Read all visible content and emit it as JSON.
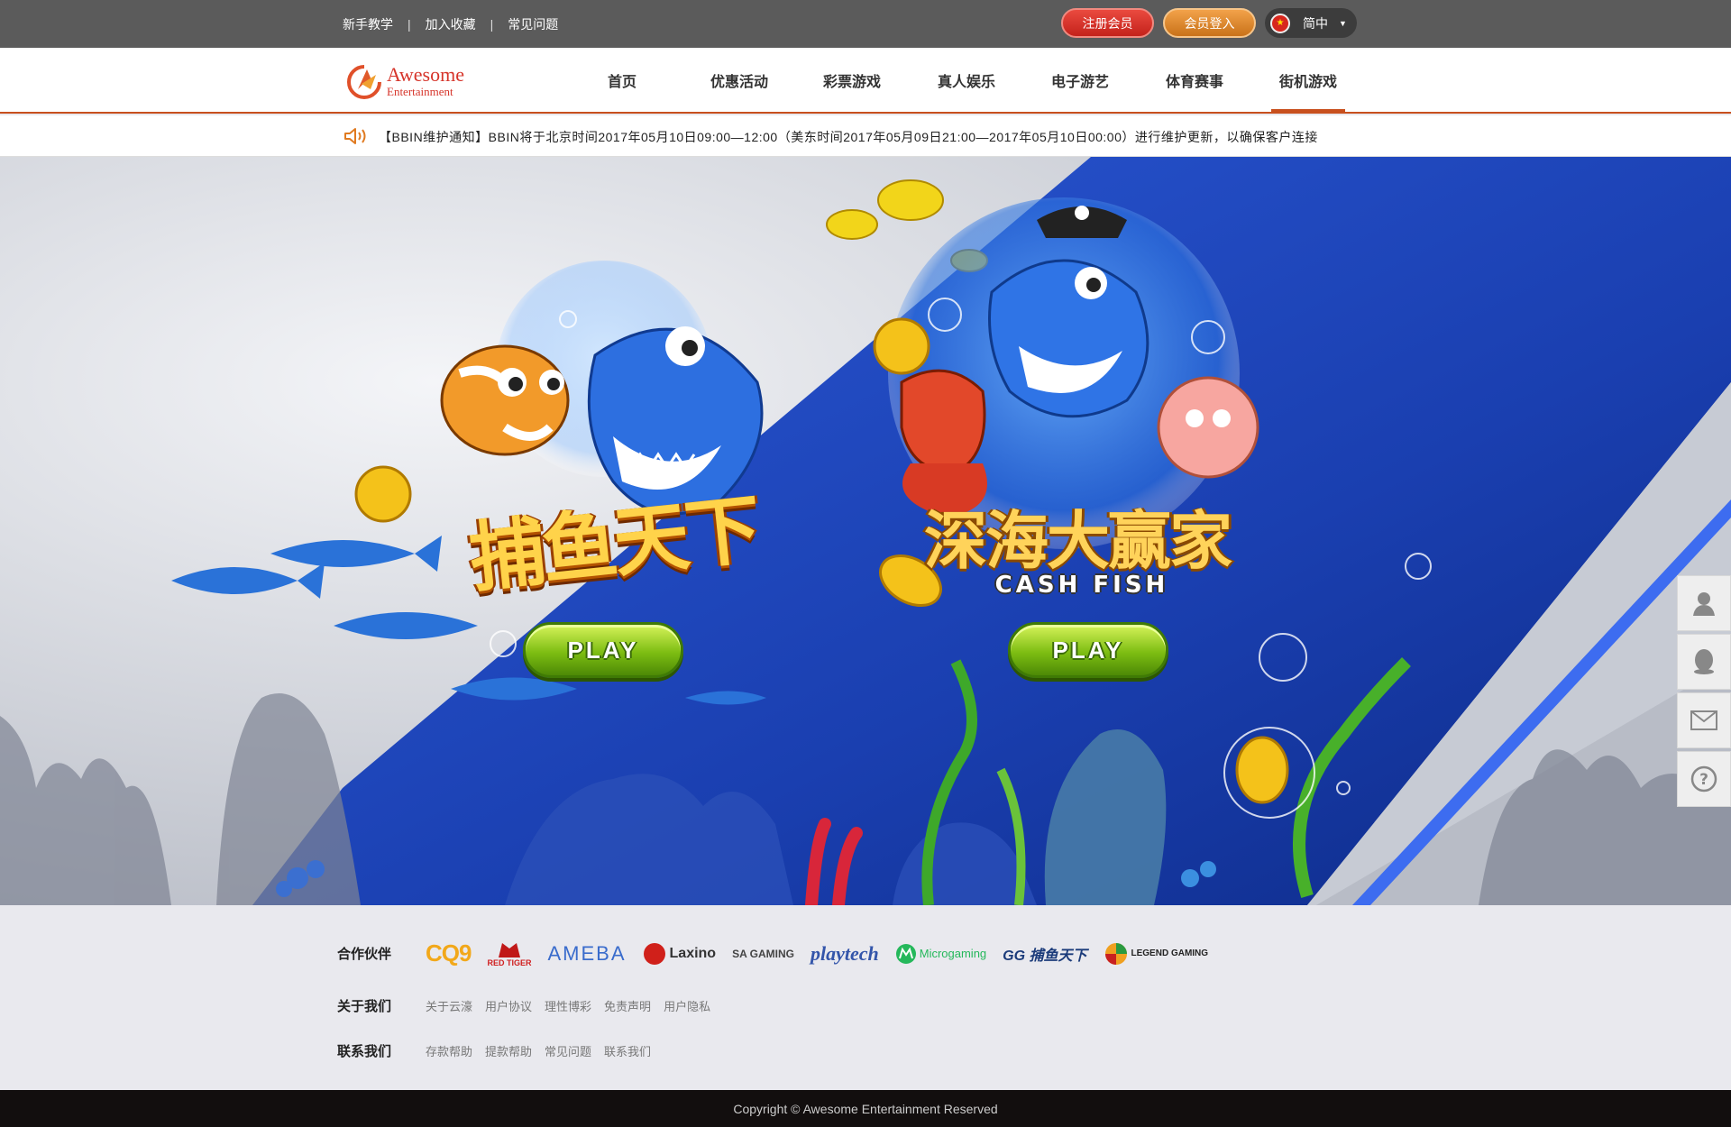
{
  "topbar": {
    "links": [
      "新手教学",
      "加入收藏",
      "常见问题"
    ],
    "register": "注册会员",
    "login": "会员登入",
    "language": "简中"
  },
  "logo": {
    "line1": "Awesome",
    "line2": "Entertainment"
  },
  "nav": [
    "首页",
    "优惠活动",
    "彩票游戏",
    "真人娱乐",
    "电子游艺",
    "体育赛事",
    "街机游戏"
  ],
  "nav_active": "街机游戏",
  "notice": "【BBIN维护通知】BBIN将于北京时间2017年05月10日09:00—12:00（美东时间2017年05月09日21:00—2017年05月10日00:00）进行维护更新，以确保客户连接",
  "hero": {
    "game_left_title": "捕鱼天下",
    "game_right_title": "深海大赢家",
    "game_right_subtitle": "CASH FISH",
    "play_label": "PLAY"
  },
  "footer": {
    "partners_label": "合作伙伴",
    "partners": [
      "CQ9",
      "RED TIGER",
      "AMEBA",
      "Laxino",
      "SA GAMING",
      "playtech",
      "Microgaming",
      "GG 捕鱼天下",
      "LEGEND GAMING"
    ],
    "about_label": "关于我们",
    "about_links": [
      "关于云濠",
      "用户协议",
      "理性博彩",
      "免责声明",
      "用户隐私"
    ],
    "contact_label": "联系我们",
    "contact_links": [
      "存款帮助",
      "提款帮助",
      "常见问题",
      "联系我们"
    ]
  },
  "copyright": "Copyright © Awesome Entertainment Reserved",
  "colors": {
    "accent": "#c8501e",
    "topbar": "#5b5b5b",
    "register": "#d6302a",
    "login": "#e08a2c",
    "footer_bottom": "#120e0e"
  }
}
